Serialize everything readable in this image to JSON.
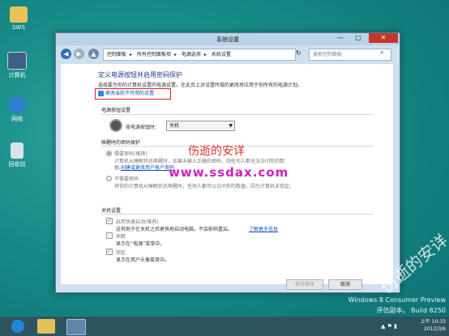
{
  "desktop": {
    "icons": [
      {
        "label": "SWS"
      },
      {
        "label": "计算机"
      },
      {
        "label": "网络"
      },
      {
        "label": "回收站"
      }
    ]
  },
  "window": {
    "title": "系统设置",
    "minimize": "—",
    "maximize": "□",
    "close": "✕",
    "breadcrumbs": [
      "控制面板",
      "所有控制面板项",
      "电源选项",
      "系统设置"
    ],
    "search_placeholder": "搜索控制面板"
  },
  "content": {
    "heading": "定义电源按钮并启用密码保护",
    "description": "选择要为你的计算机设置的电源设置。在此页上对设置所做的更改将应用于你所有的电源计划。",
    "change_link": "更改当前不可用的设置",
    "section_power_button": "电源按钮设置",
    "power_button_label": "按电源按钮时:",
    "power_button_value": "关机",
    "section_password": "唤醒时的密码保护",
    "require_password": "需要密码(推荐)",
    "require_password_desc1": "计算机从睡眠状态唤醒时，如果未输入正确的密码，则任何人都无法访问你的数",
    "require_password_desc2": "据。",
    "create_password_link": "创建或更改用户帐户密码",
    "no_password": "不需要密码",
    "no_password_desc": "将你的计算机从睡眠状态唤醒时，任何人都可以访问你的数据，因为计算机未锁定。",
    "section_shutdown": "关机设置",
    "fast_startup": "启用快速启动(推荐)",
    "fast_startup_desc": "这有助于在关机之后更快地启动电脑。不会影响重启。",
    "learn_more_link": "了解更多信息",
    "hibernate": "休眠",
    "hibernate_desc": "显示在“电源”菜单中。",
    "lock": "锁定",
    "lock_desc": "显示在用户头像菜单中。",
    "save_button": "保存修改",
    "cancel_button": "取消"
  },
  "watermarks": {
    "cn1": "伤逝的安详",
    "url": "www.ssdax.com",
    "cn2": "伤逝的安详"
  },
  "system_info": {
    "line1": "Windows 8 Consumer Preview",
    "line2": "评估副本。 Build 8250"
  },
  "taskbar": {
    "time": "上午 10:33",
    "date": "2012/3/6"
  }
}
